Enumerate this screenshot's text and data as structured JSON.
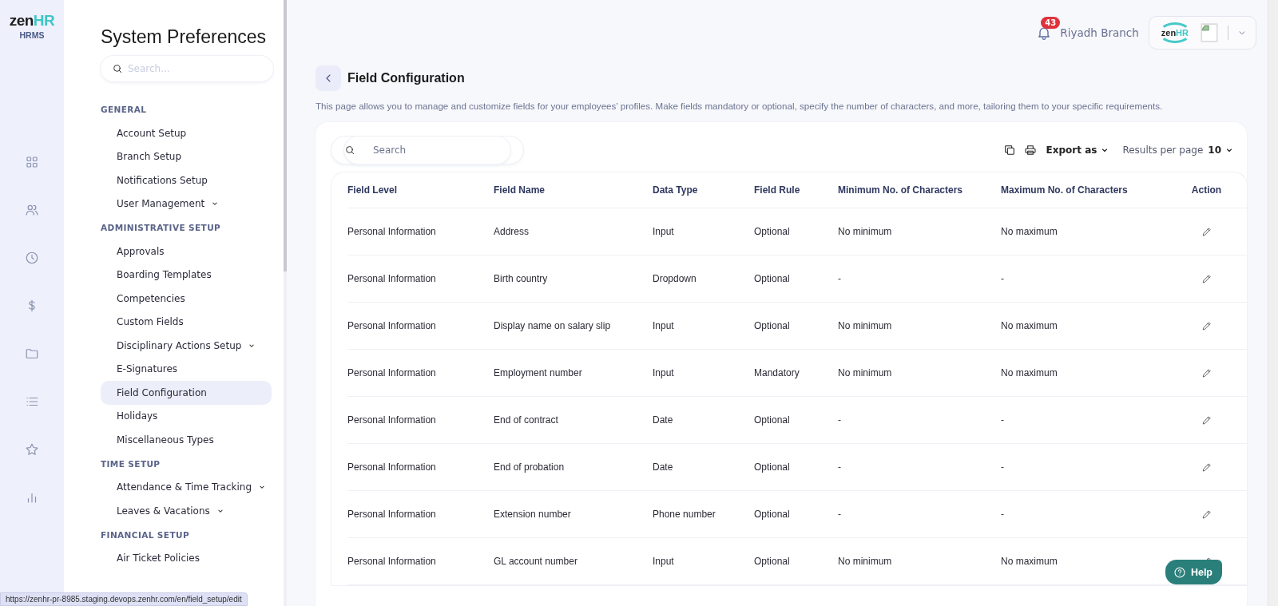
{
  "brand": {
    "logo_left": "zen",
    "logo_right": "HR",
    "subtitle": "HRMS"
  },
  "rail": [
    {
      "kind": "grid"
    },
    {
      "kind": "people"
    },
    {
      "kind": "clock"
    },
    {
      "kind": "dollar"
    },
    {
      "kind": "folder"
    },
    {
      "kind": "list"
    },
    {
      "kind": "star"
    },
    {
      "kind": "chart"
    }
  ],
  "sidebar": {
    "title": "System Preferences",
    "search_placeholder": "Search...",
    "sections": [
      {
        "heading": "GENERAL",
        "items": [
          {
            "label": "Account Setup",
            "expandable": false,
            "selected": false
          },
          {
            "label": "Branch Setup",
            "expandable": false,
            "selected": false
          },
          {
            "label": "Notifications Setup",
            "expandable": false,
            "selected": false
          },
          {
            "label": "User Management",
            "expandable": true,
            "selected": false
          }
        ]
      },
      {
        "heading": "ADMINISTRATIVE SETUP",
        "items": [
          {
            "label": "Approvals",
            "expandable": false,
            "selected": false
          },
          {
            "label": "Boarding Templates",
            "expandable": false,
            "selected": false
          },
          {
            "label": "Competencies",
            "expandable": false,
            "selected": false
          },
          {
            "label": "Custom Fields",
            "expandable": false,
            "selected": false
          },
          {
            "label": "Disciplinary Actions Setup",
            "expandable": true,
            "selected": false
          },
          {
            "label": "E-Signatures",
            "expandable": false,
            "selected": false
          },
          {
            "label": "Field Configuration",
            "expandable": false,
            "selected": true
          },
          {
            "label": "Holidays",
            "expandable": false,
            "selected": false
          },
          {
            "label": "Miscellaneous Types",
            "expandable": false,
            "selected": false
          }
        ]
      },
      {
        "heading": "TIME SETUP",
        "items": [
          {
            "label": "Attendance & Time Tracking",
            "expandable": true,
            "selected": false
          },
          {
            "label": "Leaves & Vacations",
            "expandable": true,
            "selected": false
          }
        ]
      },
      {
        "heading": "FINANCIAL SETUP",
        "items": [
          {
            "label": "Air Ticket Policies",
            "expandable": false,
            "selected": false
          }
        ]
      }
    ]
  },
  "header": {
    "notification_count": "43",
    "branch": "Riyadh Branch",
    "company_logo_left": "zen",
    "company_logo_right": "HR"
  },
  "page": {
    "title": "Field Configuration",
    "description": "This page allows you to manage and customize fields for your employees’ profiles. Make fields mandatory or optional, specify the number of characters, and more, tailoring them to your specific requirements."
  },
  "toolbar": {
    "search_placeholder": "Search",
    "export_label": "Export as",
    "results_label": "Results per page",
    "results_value": "10"
  },
  "table": {
    "columns": [
      "Field Level",
      "Field Name",
      "Data Type",
      "Field Rule",
      "Minimum No. of Characters",
      "Maximum No. of Characters",
      "Action"
    ],
    "rows": [
      [
        "Personal Information",
        "Address",
        "Input",
        "Optional",
        "No minimum",
        "No maximum"
      ],
      [
        "Personal Information",
        "Birth country",
        "Dropdown",
        "Optional",
        "-",
        "-"
      ],
      [
        "Personal Information",
        "Display name on salary slip",
        "Input",
        "Optional",
        "No minimum",
        "No maximum"
      ],
      [
        "Personal Information",
        "Employment number",
        "Input",
        "Mandatory",
        "No minimum",
        "No maximum"
      ],
      [
        "Personal Information",
        "End of contract",
        "Date",
        "Optional",
        "-",
        "-"
      ],
      [
        "Personal Information",
        "End of probation",
        "Date",
        "Optional",
        "-",
        "-"
      ],
      [
        "Personal Information",
        "Extension number",
        "Phone number",
        "Optional",
        "-",
        "-"
      ],
      [
        "Personal Information",
        "GL account number",
        "Input",
        "Optional",
        "No minimum",
        "No maximum"
      ]
    ]
  },
  "help_button": "Help",
  "status_bar": "https://zenhr-pr-8985.staging.devops.zenhr.com/en/field_setup/edit"
}
